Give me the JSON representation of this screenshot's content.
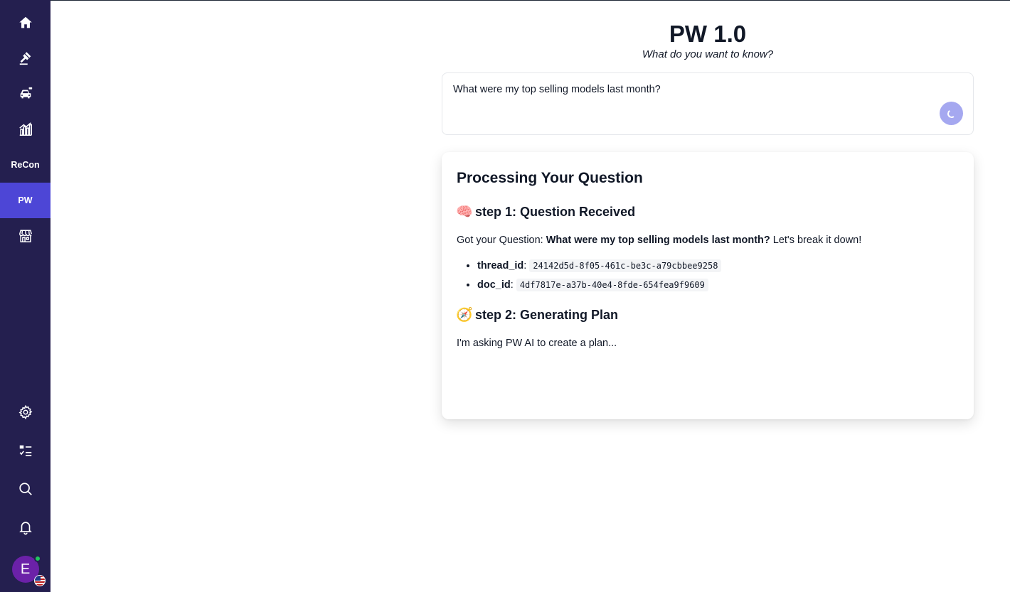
{
  "sidebar": {
    "items": [
      {
        "icon": "home-icon"
      },
      {
        "icon": "gavel-icon"
      },
      {
        "icon": "car-icon"
      },
      {
        "icon": "bar-chart-icon"
      },
      {
        "label": "ReCon"
      },
      {
        "label": "PW",
        "active": true
      },
      {
        "icon": "store-icon"
      }
    ],
    "bottom": [
      {
        "icon": "gear-icon"
      },
      {
        "icon": "checklist-icon"
      },
      {
        "icon": "search-icon"
      },
      {
        "icon": "bell-icon"
      }
    ],
    "avatar": {
      "initial": "E"
    }
  },
  "header": {
    "title": "PW 1.0",
    "subtitle": "What do you want to know?"
  },
  "query": {
    "text": "What were my top selling models last month?"
  },
  "card": {
    "title": "Processing Your Question",
    "step1": {
      "emoji": "🧠",
      "title": "step 1: Question Received",
      "intro_prefix": "Got your Question: ",
      "question": "What were my top selling models last month?",
      "intro_suffix": " Let's break it down!",
      "details": [
        {
          "key": "thread_id",
          "value": "24142d5d-8f05-461c-be3c-a79cbbee9258"
        },
        {
          "key": "doc_id",
          "value": "4df7817e-a37b-40e4-8fde-654fea9f9609"
        }
      ]
    },
    "step2": {
      "emoji": "🧭",
      "title": "step 2: Generating Plan",
      "text": "I'm asking PW AI to create a plan..."
    }
  },
  "colors": {
    "sidebar_bg": "#241f4f",
    "active_item": "#4d46d6",
    "spinner": "#a5a8f0"
  }
}
